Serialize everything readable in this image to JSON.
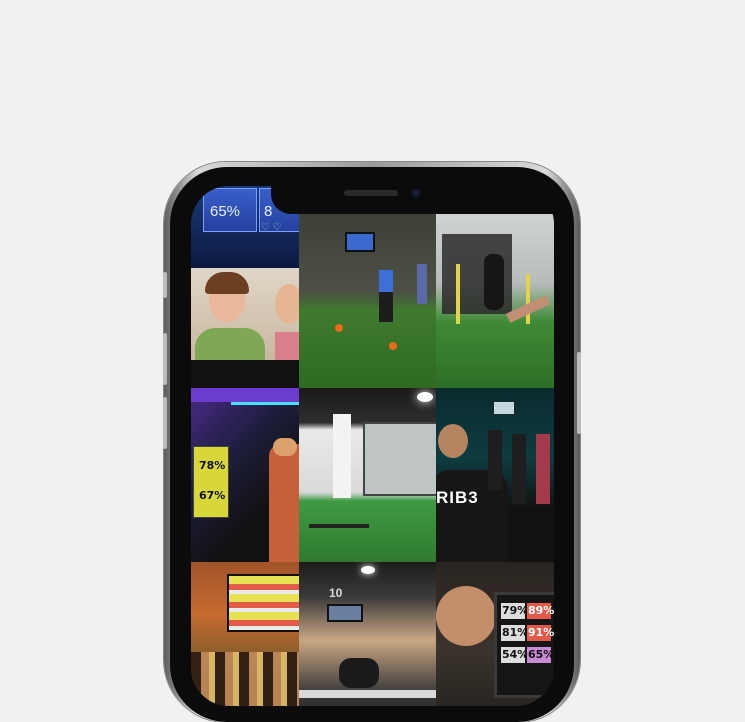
{
  "colors": {
    "background": "#f1f1f1",
    "phone_frame": "#c9c9c9",
    "screen": "#111111"
  },
  "top_strip": {
    "percent_a": "65%",
    "percent_b": "8"
  },
  "photos": {
    "bike_screen": {
      "values": [
        "78%",
        "67%"
      ]
    },
    "gym_screen": {
      "values": [
        "79%",
        "89%",
        "81%",
        "91%",
        "54%",
        "65%"
      ]
    },
    "shirt_text": "RIB3",
    "wall_number": "10"
  }
}
